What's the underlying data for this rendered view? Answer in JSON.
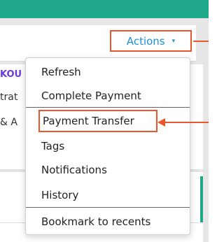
{
  "header": {
    "actions_label": "Actions",
    "caret_glyph": "▾"
  },
  "background": {
    "purple_label": "KOU",
    "line2": "trat",
    "line3": "& A"
  },
  "menu": {
    "items": [
      {
        "label": "Refresh"
      },
      {
        "label": "Complete Payment"
      },
      {
        "label": "Payment Transfer"
      },
      {
        "label": "Tags"
      },
      {
        "label": "Notifications"
      },
      {
        "label": "History"
      },
      {
        "label": "Bookmark to recents"
      }
    ],
    "highlighted_item": "Payment Transfer"
  },
  "colors": {
    "accent_teal": "#1fa889",
    "link_blue": "#1f8fd6",
    "callout_orange": "#e8562a",
    "tag_purple": "#6b3bd6"
  }
}
